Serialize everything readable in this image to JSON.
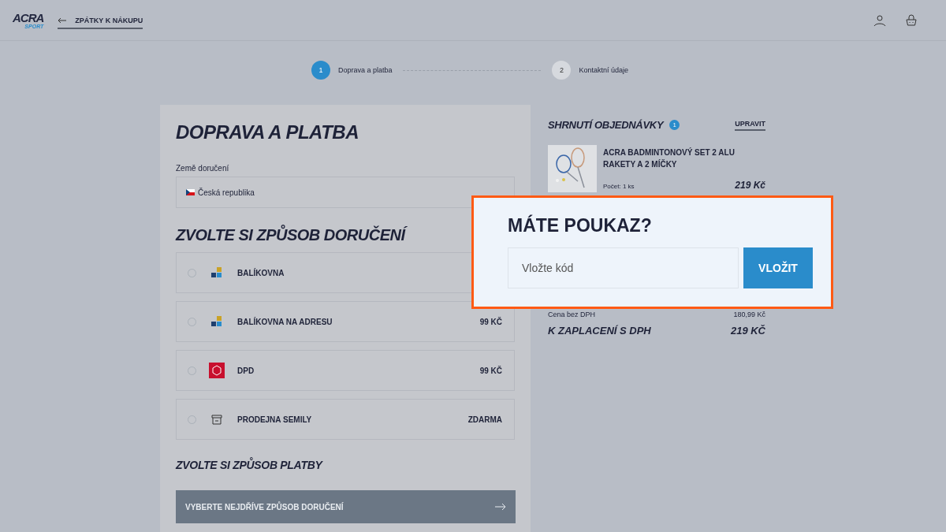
{
  "header": {
    "logo": "ACRA",
    "logo_sub": "SPORT",
    "back_link": "ZPÁTKY K NÁKUPU"
  },
  "steps": [
    {
      "number": "1",
      "label": "Doprava a platba",
      "selected": true
    },
    {
      "number": "2",
      "label": "Kontaktní údaje",
      "selected": false
    }
  ],
  "shipping_form": {
    "title": "DOPRAVA A PLATBA",
    "country_label": "Země doručení",
    "country": "Česká republika",
    "delivery_heading": "ZVOLTE SI ZPŮSOB DORUČENÍ",
    "delivery_options": [
      {
        "kind": "balikovna",
        "name": "BALÍKOVNA",
        "selected": false
      },
      {
        "kind": "balikovna",
        "name": "BALÍKOVNA NA ADRESU",
        "price": "99 KČ",
        "selected": false
      },
      {
        "kind": "dpd",
        "name": "DPD",
        "price": "99 KČ",
        "selected": false
      },
      {
        "kind": "store",
        "name": "PRODEJNA SEMILY",
        "price": "ZDARMA",
        "selected": false
      }
    ],
    "payment_heading": "ZVOLTE SI ZPŮSOB PLATBY",
    "payment_button": "VYBERTE NEJDŘÍVE ZPŮSOB DORUČENÍ"
  },
  "summary": {
    "title": "SHRNUTÍ OBJEDNÁVKY",
    "badge": "1",
    "edit": "UPRAVIT",
    "product": {
      "name": "ACRA BADMINTONOVÝ SET 2 ALU RAKETY A 2 MÍČKY",
      "quantity": "Počet: 1 ks",
      "price": "219 Kč"
    },
    "net_label": "Cena bez DPH",
    "net_value": "180,99 Kč",
    "total_label": "K ZAPLACENÍ S DPH",
    "total_value": "219 KČ"
  },
  "voucher_popup": {
    "title": "MÁTE POUKAZ?",
    "placeholder": "Vložte kód",
    "button": "VLOŽIT"
  }
}
